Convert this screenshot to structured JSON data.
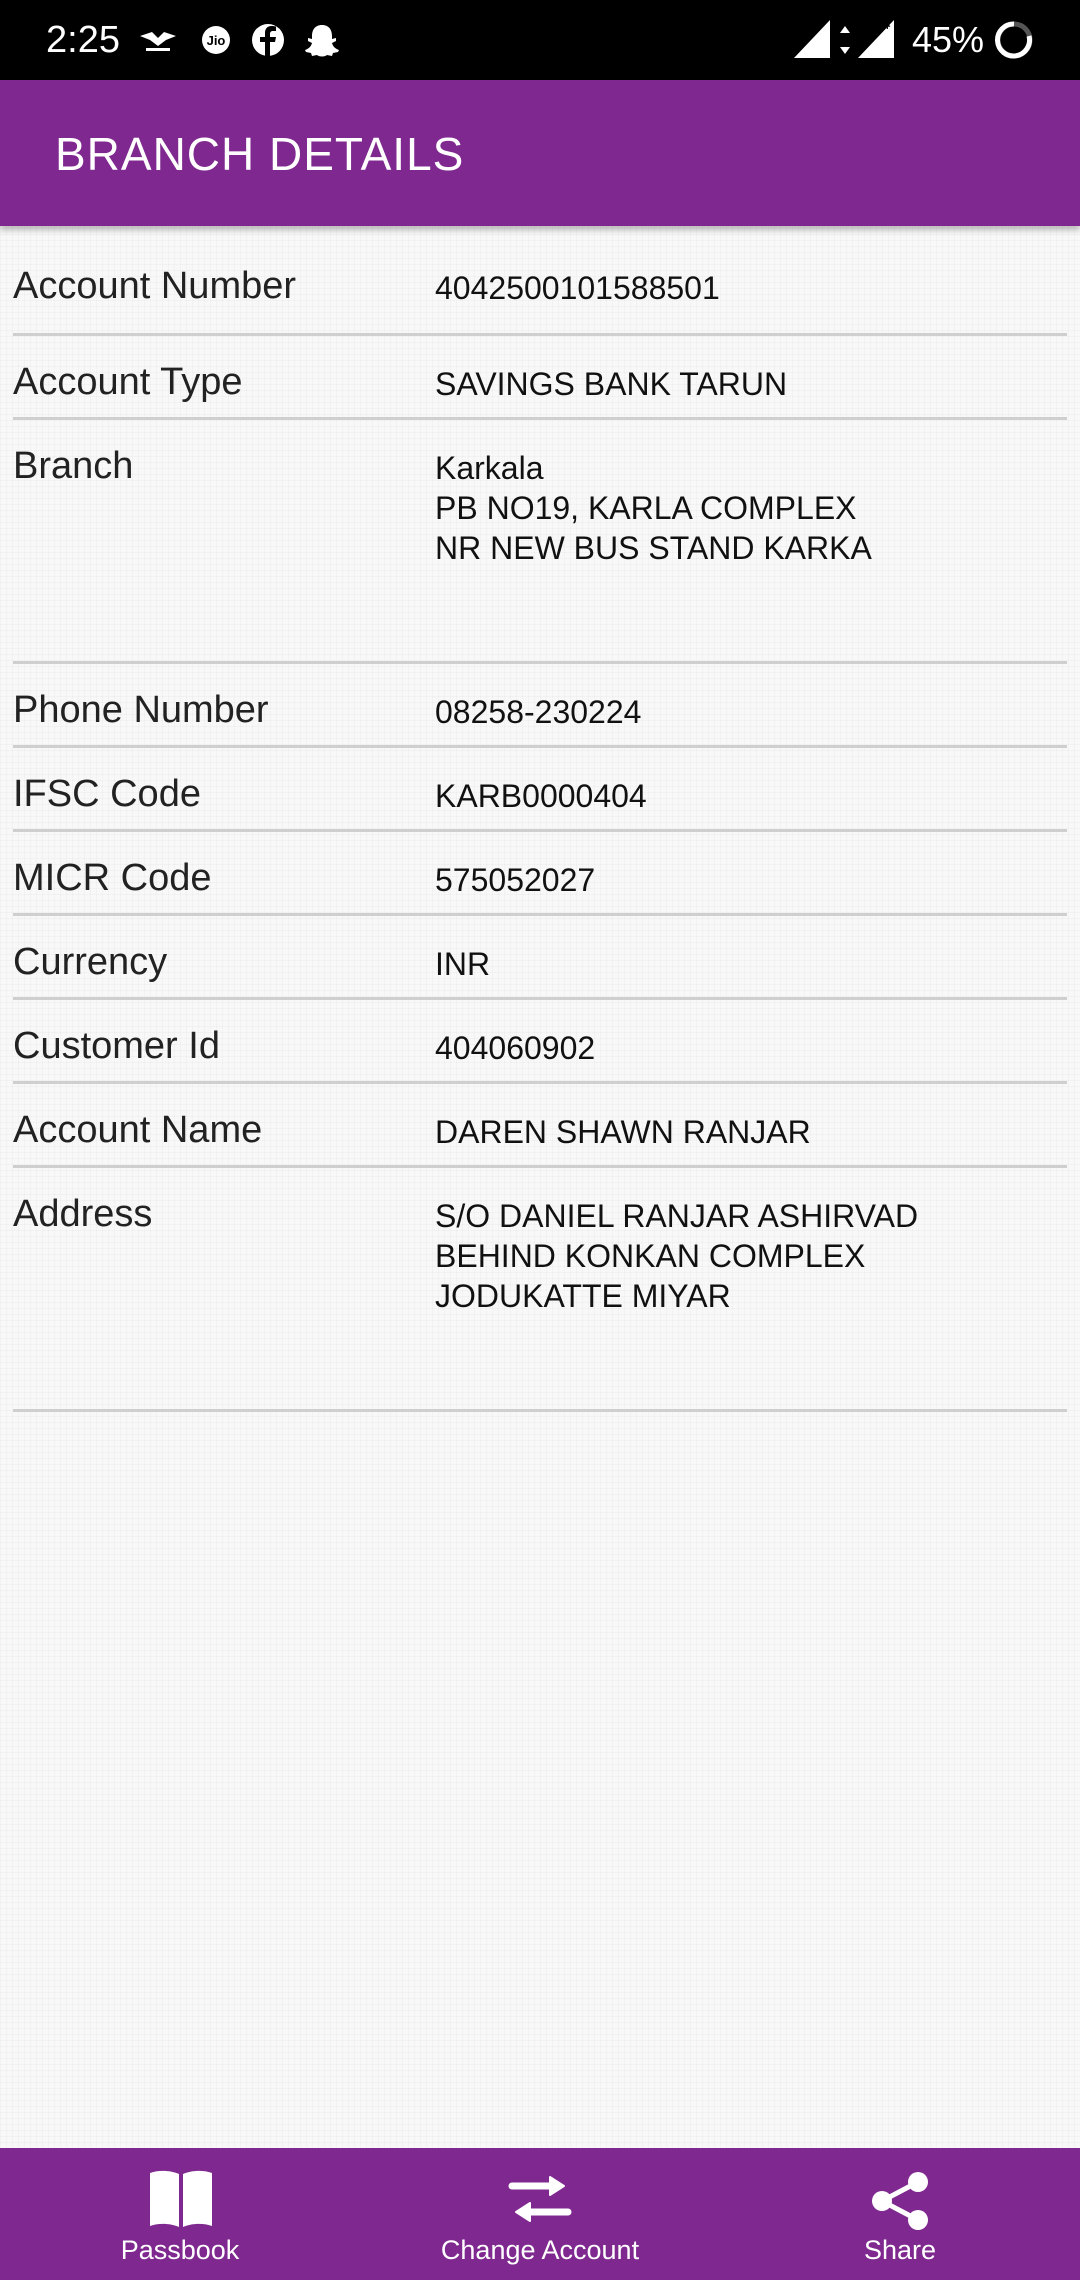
{
  "status_bar": {
    "time": "2:25",
    "battery": "45%",
    "network": "4G+",
    "icons": [
      "notification-app-icon",
      "jio-icon",
      "facebook-icon",
      "snapchat-icon",
      "signal-icon",
      "data-transfer-icon",
      "signal-4g-icon",
      "battery-ring-icon"
    ]
  },
  "app_bar": {
    "title": "BRANCH DETAILS",
    "color": "#7f288f"
  },
  "details": [
    {
      "label": "Account Number",
      "value": "4042500101588501"
    },
    {
      "label": "Account Type",
      "value": "SAVINGS BANK TARUN"
    },
    {
      "label": "Branch",
      "value": "Karkala\nPB NO19, KARLA COMPLEX\nNR NEW BUS STAND KARKA"
    },
    {
      "label": "Phone Number",
      "value": "08258-230224"
    },
    {
      "label": "IFSC Code",
      "value": "KARB0000404"
    },
    {
      "label": "MICR Code",
      "value": "575052027"
    },
    {
      "label": "Currency",
      "value": "INR"
    },
    {
      "label": "Customer Id",
      "value": "404060902"
    },
    {
      "label": "Account Name",
      "value": "DAREN SHAWN RANJAR"
    },
    {
      "label": "Address",
      "value": "S/O DANIEL RANJAR ASHIRVAD\nBEHIND KONKAN COMPLEX\nJODUKATTE MIYAR"
    }
  ],
  "bottom_nav": {
    "passbook_label": "Passbook",
    "change_account_label": "Change Account",
    "share_label": "Share"
  }
}
